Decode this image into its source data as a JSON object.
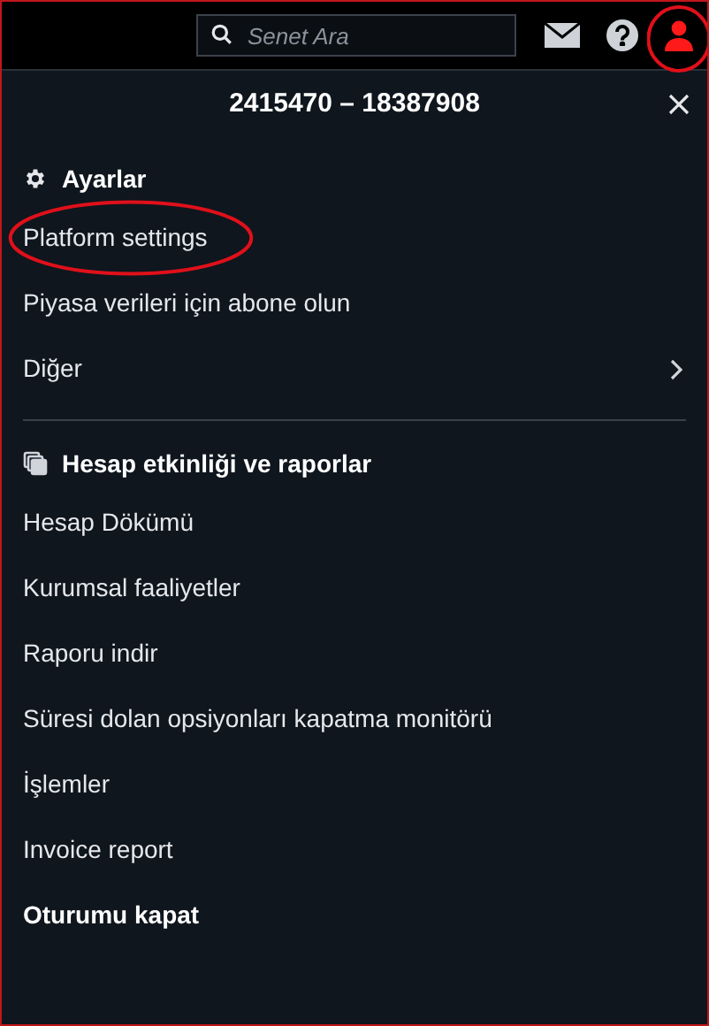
{
  "top_bar": {
    "search": {
      "placeholder": "Senet Ara"
    },
    "user_circled": true
  },
  "panel": {
    "title": "2415470 – 18387908",
    "sections": [
      {
        "title": "Ayarlar",
        "items": [
          {
            "label": "Platform settings",
            "kind": "link",
            "circled": true
          },
          {
            "label": "Piyasa verileri için abone olun",
            "kind": "link",
            "circled": false
          },
          {
            "label": "Diğer",
            "kind": "submenu",
            "circled": false
          }
        ]
      },
      {
        "title": "Hesap etkinliği ve raporlar",
        "items": [
          {
            "label": "Hesap Dökümü",
            "kind": "link",
            "circled": false
          },
          {
            "label": "Kurumsal faaliyetler",
            "kind": "link",
            "circled": false
          },
          {
            "label": "Raporu indir",
            "kind": "link",
            "circled": false
          },
          {
            "label": "Süresi dolan opsiyonları kapatma monitörü",
            "kind": "link",
            "circled": false
          },
          {
            "label": "İşlemler",
            "kind": "link",
            "circled": false
          },
          {
            "label": "Invoice report",
            "kind": "link",
            "circled": false
          },
          {
            "label": "Oturumu kapat",
            "kind": "logout",
            "circled": false
          }
        ]
      }
    ]
  }
}
